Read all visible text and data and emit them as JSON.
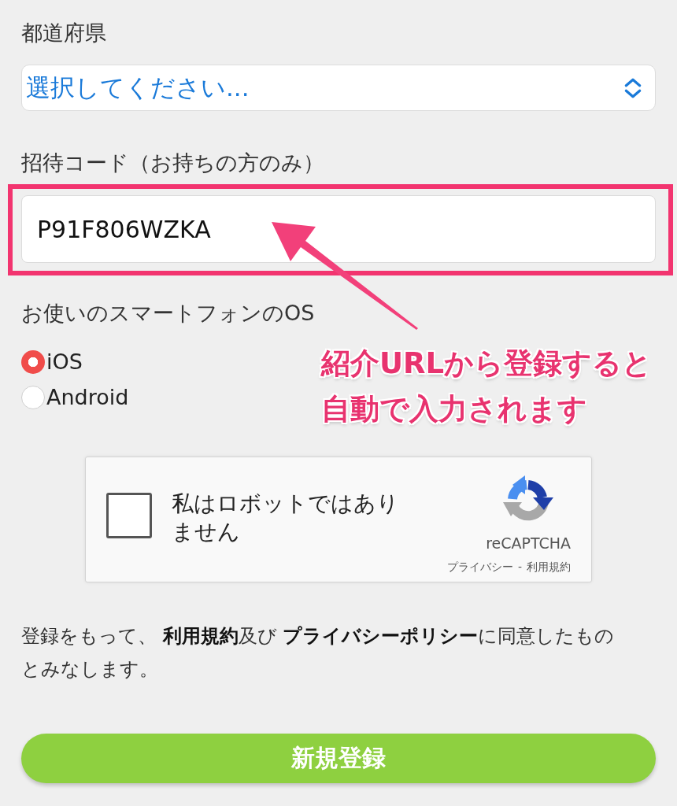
{
  "prefecture": {
    "label": "都道府県",
    "select": {
      "value": "選択してください..."
    }
  },
  "invite_code": {
    "label": "招待コード（お持ちの方のみ）",
    "value": "P91F806WZKA",
    "highlighted": true
  },
  "os": {
    "label": "お使いのスマートフォンのOS",
    "options": [
      {
        "label": "iOS",
        "selected": true
      },
      {
        "label": "Android",
        "selected": false
      }
    ]
  },
  "annotation": {
    "lines": [
      "紹介URLから登録すると",
      "自動で入力されます"
    ]
  },
  "captcha": {
    "checked": false,
    "label": "私はロボットではありません",
    "brand": "reCAPTCHA",
    "privacy_link": "プライバシー",
    "separator": "-",
    "terms_link": "利用規約"
  },
  "consent": "登録をもって、 **利用規約**及び **プライバシーポリシー**に同意したものとみなします。",
  "submit": "新規登録"
}
